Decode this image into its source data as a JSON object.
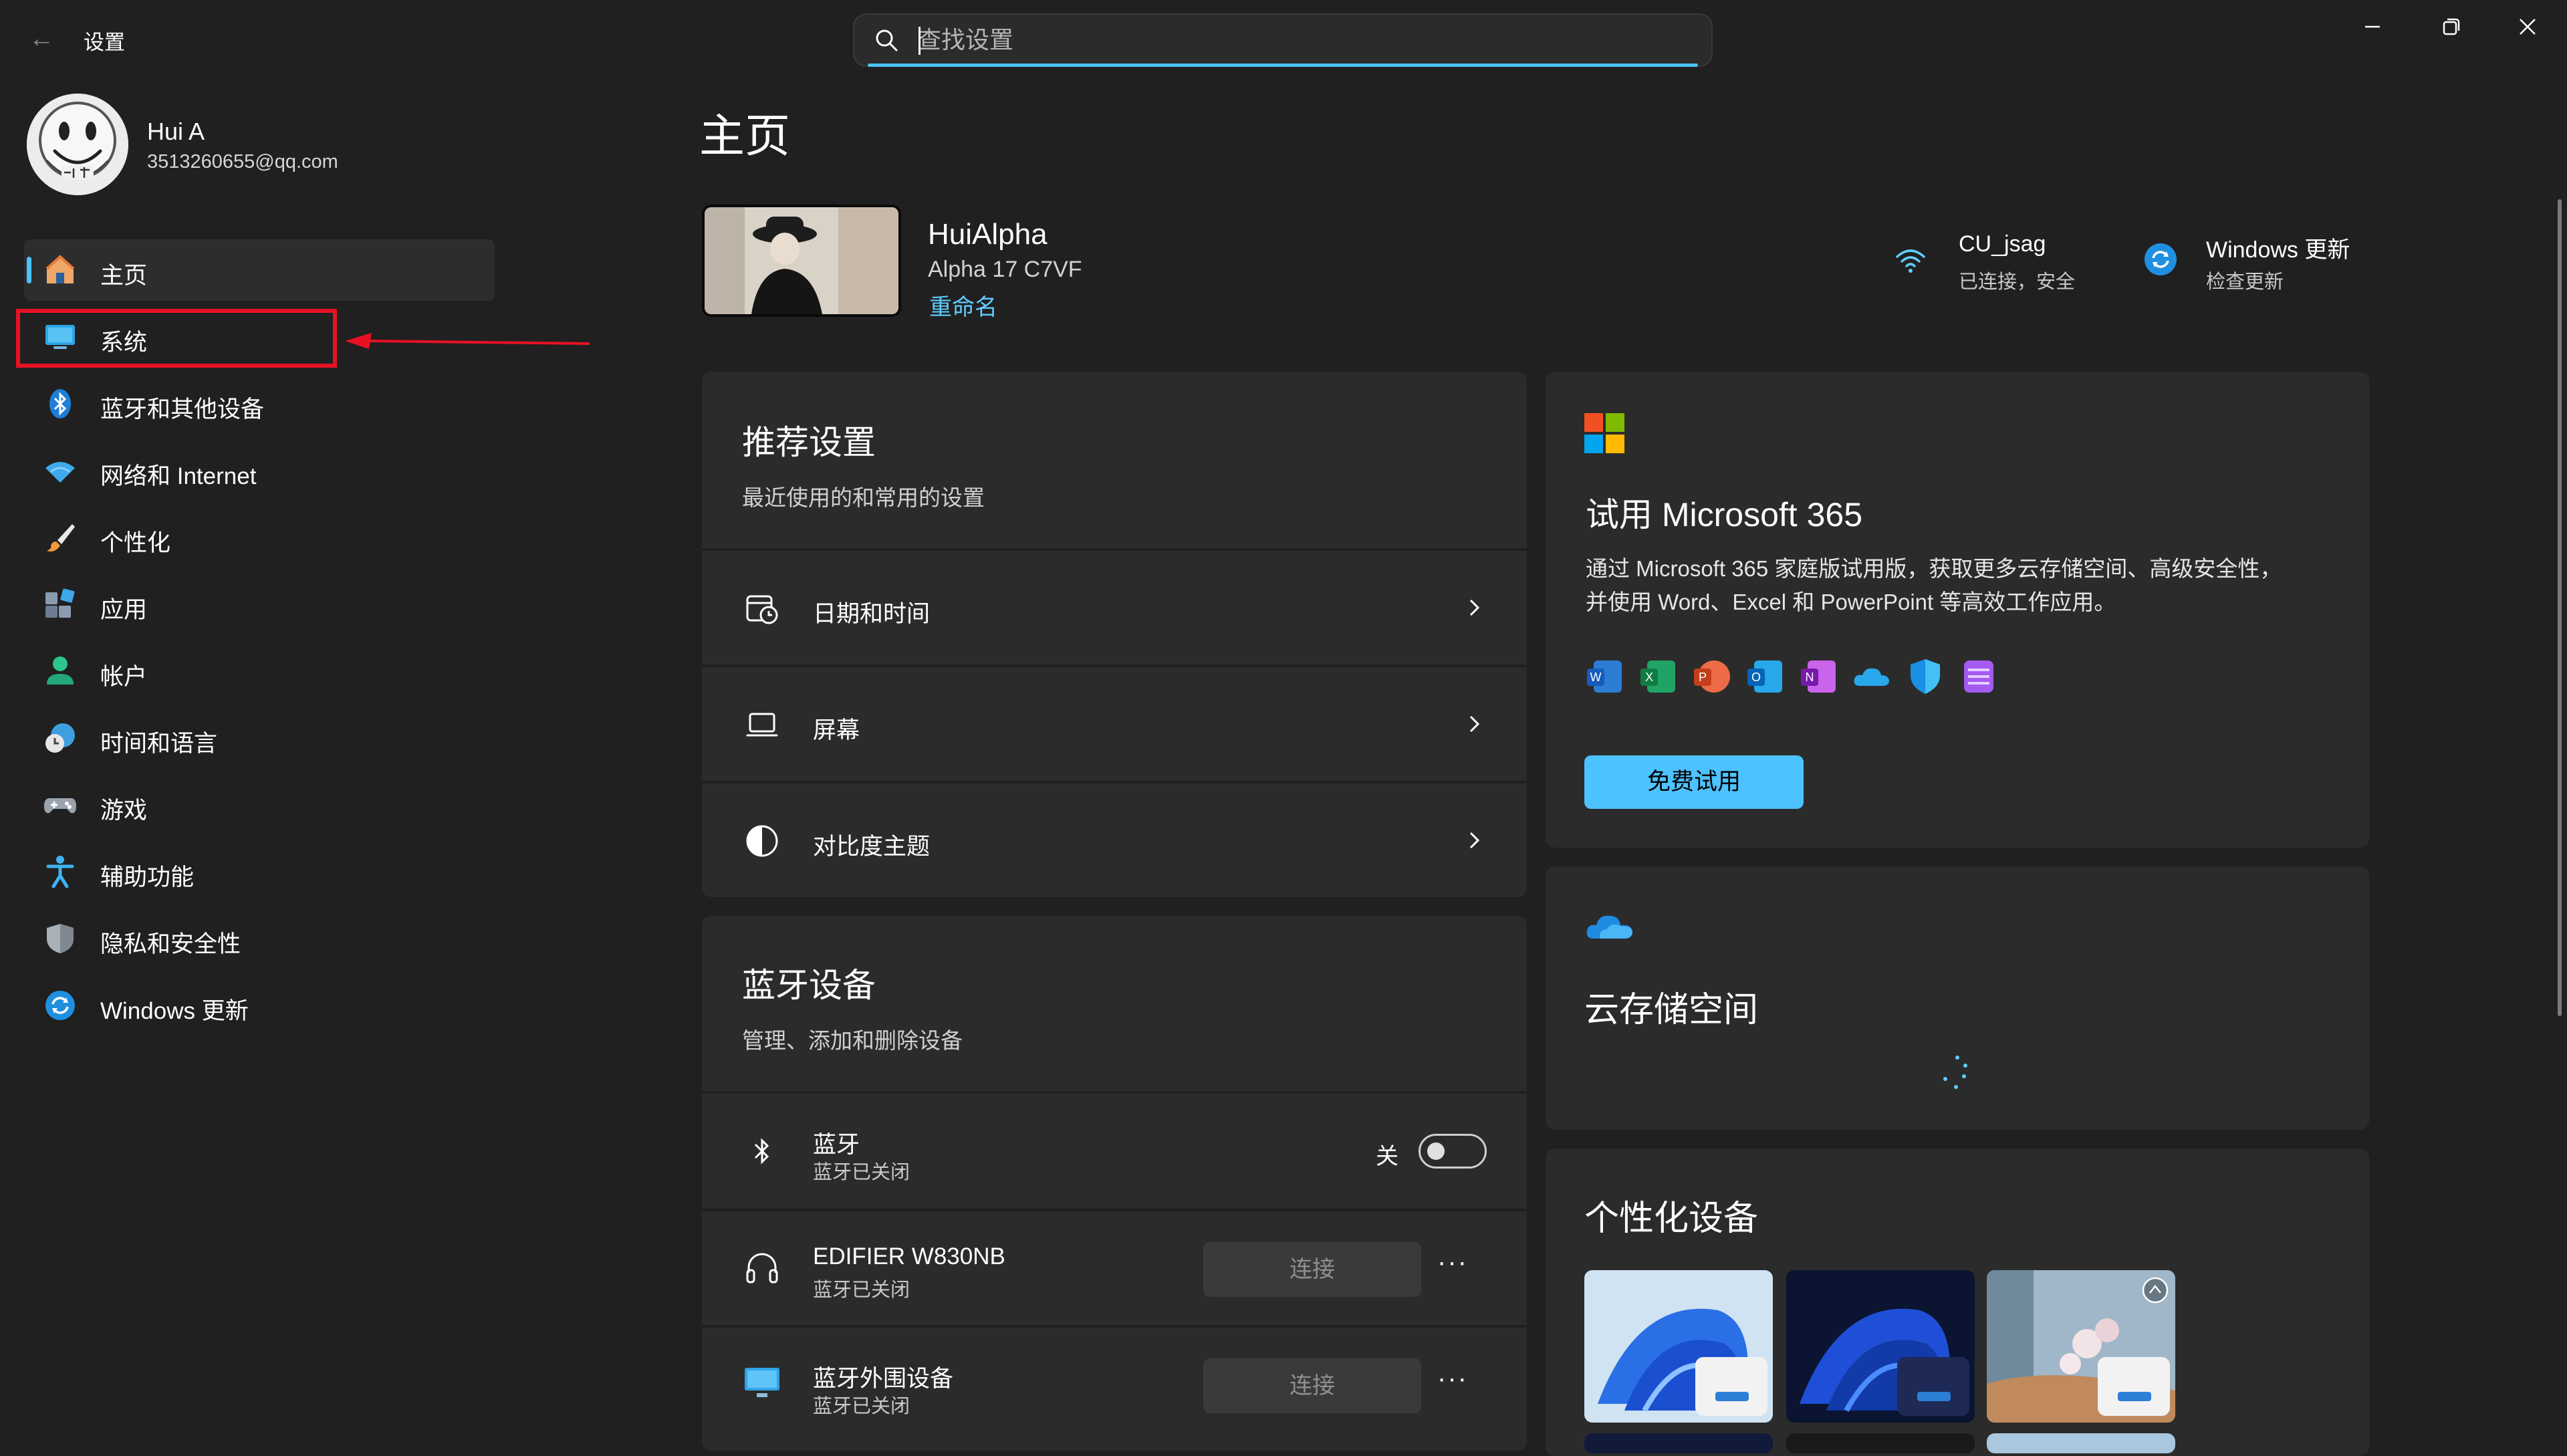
{
  "window": {
    "app_title": "设置",
    "back_glyph": "←",
    "controls": [
      "minimize-icon",
      "restore-icon",
      "close-icon"
    ]
  },
  "search": {
    "placeholder": "查找设置",
    "value": ""
  },
  "profile": {
    "name": "Hui A",
    "email": "3513260655@qq.com"
  },
  "nav": {
    "items": [
      {
        "label": "主页",
        "icon": "home-icon",
        "selected": true
      },
      {
        "label": "系统",
        "icon": "system-monitor-icon",
        "highlighted": true
      },
      {
        "label": "蓝牙和其他设备",
        "icon": "bluetooth-icon"
      },
      {
        "label": "网络和 Internet",
        "icon": "wifi-icon"
      },
      {
        "label": "个性化",
        "icon": "paintbrush-icon"
      },
      {
        "label": "应用",
        "icon": "apps-icon"
      },
      {
        "label": "帐户",
        "icon": "account-icon"
      },
      {
        "label": "时间和语言",
        "icon": "clock-globe-icon"
      },
      {
        "label": "游戏",
        "icon": "gamepad-icon"
      },
      {
        "label": "辅助功能",
        "icon": "accessibility-icon"
      },
      {
        "label": "隐私和安全性",
        "icon": "shield-icon"
      },
      {
        "label": "Windows 更新",
        "icon": "windows-update-icon"
      }
    ]
  },
  "main": {
    "page_title": "主页",
    "device": {
      "name": "HuiAlpha",
      "model": "Alpha 17 C7VF",
      "rename": "重命名"
    },
    "status": {
      "network": {
        "title": "CU_jsag",
        "sub": "已连接，安全",
        "icon": "wifi-icon"
      },
      "update": {
        "title": "Windows 更新",
        "sub": "检查更新",
        "icon": "windows-update-icon"
      }
    },
    "recommended": {
      "title": "推荐设置",
      "subtitle": "最近使用的和常用的设置",
      "rows": [
        {
          "label": "日期和时间",
          "icon": "calendar-clock-icon"
        },
        {
          "label": "屏幕",
          "icon": "laptop-screen-icon"
        },
        {
          "label": "对比度主题",
          "icon": "contrast-icon"
        }
      ]
    },
    "bluetooth": {
      "title": "蓝牙设备",
      "subtitle": "管理、添加和删除设备",
      "toggle_row": {
        "label": "蓝牙",
        "sub": "蓝牙已关闭",
        "state_label": "关",
        "on": false
      },
      "devices": [
        {
          "label": "EDIFIER W830NB",
          "sub": "蓝牙已关闭",
          "button": "连接",
          "more": "···",
          "icon": "headphones-icon"
        },
        {
          "label": "蓝牙外围设备",
          "sub": "蓝牙已关闭",
          "button": "连接",
          "more": "···",
          "icon": "monitor-device-icon"
        }
      ]
    },
    "microsoft365": {
      "title": "试用 Microsoft 365",
      "description_line1": "通过 Microsoft 365 家庭版试用版，获取更多云存储空间、高级安全性，",
      "description_line2": "并使用 Word、Excel 和 PowerPoint 等高效工作应用。",
      "button": "免费试用",
      "apps": [
        "word-icon",
        "excel-icon",
        "powerpoint-icon",
        "outlook-icon",
        "onenote-icon",
        "onedrive-icon",
        "defender-icon",
        "clipchamp-icon"
      ]
    },
    "cloud": {
      "title": "云存储空间",
      "icon": "onedrive-icon",
      "loading": true
    },
    "personalize": {
      "title": "个性化设备"
    }
  },
  "colors": {
    "accent": "#4cc2ff",
    "background": "#202020",
    "card": "#2b2b2b",
    "highlight": "#e81123"
  }
}
